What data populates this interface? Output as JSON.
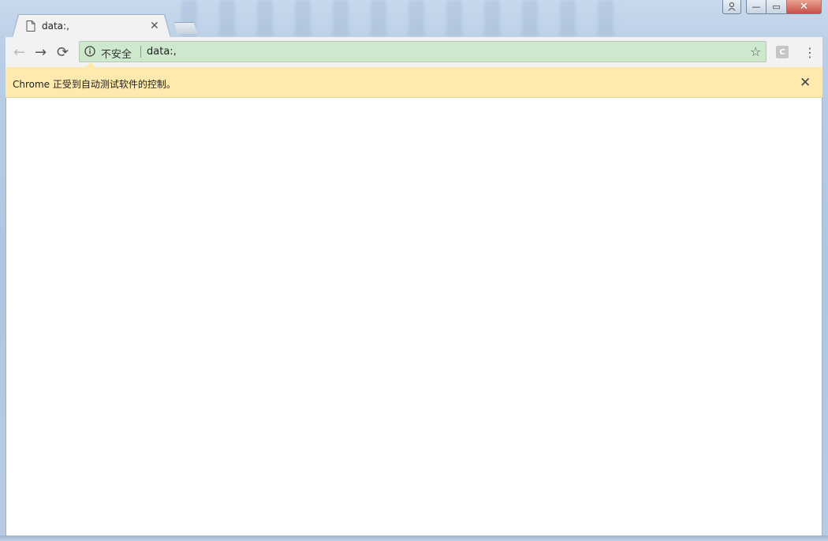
{
  "tab": {
    "title": "data:,",
    "close_glyph": "✕"
  },
  "window_controls": {
    "min": "—",
    "max": "▭",
    "close": "✕"
  },
  "toolbar": {
    "back": "←",
    "forward": "→",
    "reload": "⟳",
    "star": "☆",
    "menu": "⋮",
    "extension_letter": "C"
  },
  "omnibox": {
    "security_label": "不安全",
    "url": "data:,"
  },
  "infobar": {
    "message": "Chrome 正受到自动测试软件的控制。",
    "close_glyph": "✕"
  },
  "icons": [
    "page-icon",
    "info-icon",
    "user-icon",
    "star-icon",
    "menu-icon",
    "extension-icon"
  ],
  "colors": {
    "omnibox_bg": "#cde8cd",
    "infobar_bg": "#feeaae",
    "tab_bg": "#f2f2f2",
    "close_red": "#c75048"
  }
}
